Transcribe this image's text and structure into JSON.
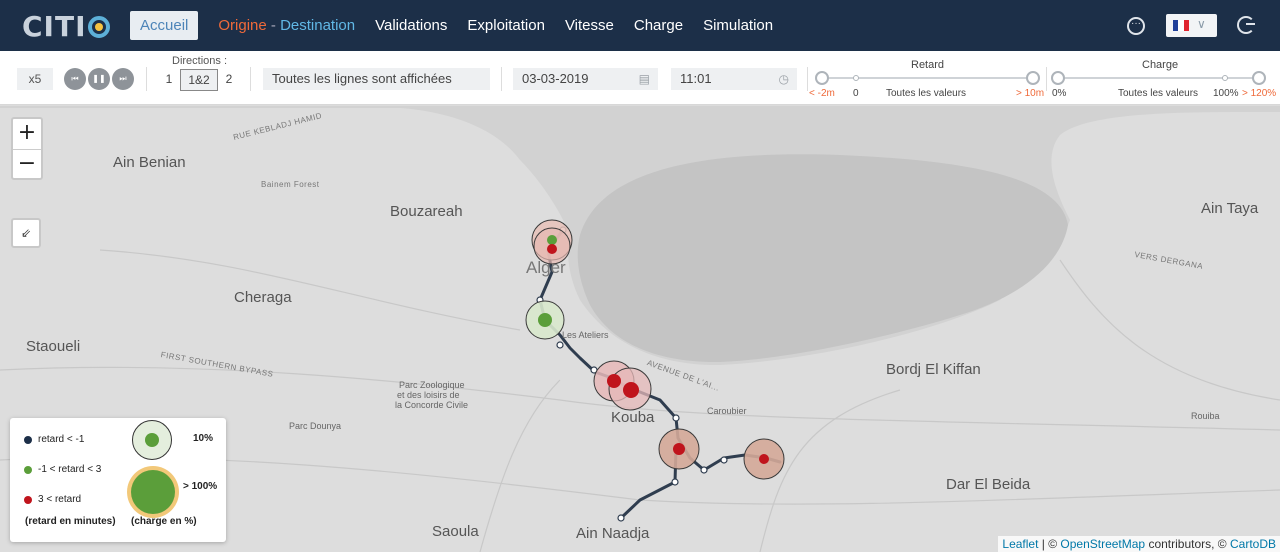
{
  "nav": {
    "logo": "CITI",
    "items": [
      "Accueil",
      "Validations",
      "Exploitation",
      "Vitesse",
      "Charge",
      "Simulation"
    ],
    "origin": "Origine",
    "dash": "-",
    "destination": "Destination"
  },
  "toolbar": {
    "speed": "x5",
    "directions_label": "Directions :",
    "dir1": "1",
    "dir12": "1&2",
    "dir2": "2",
    "lines": "Toutes les lignes sont affichées",
    "date": "03-03-2019",
    "time": "11:01",
    "retard": {
      "title": "Retard",
      "min": "< -2m",
      "zero": "0",
      "all": "Toutes les valeurs",
      "max": "> 10m"
    },
    "charge": {
      "title": "Charge",
      "min": "0%",
      "all": "Toutes les valeurs",
      "hundred": "100%",
      "max": "> 120%"
    }
  },
  "map": {
    "places": [
      "Ain Benian",
      "Bouzareah",
      "Cheraga",
      "Staoueli",
      "Ain Taya",
      "Bordj El Kiffan",
      "Dar El Beida",
      "Kouba",
      "Saoula",
      "Ain Naadja",
      "Alger",
      "Caroubier",
      "Parc Dounya",
      "Parc Zoologique",
      "et des loisirs de",
      "la Concorde Civile",
      "Rouiba",
      "Les Ateliers",
      "Bainem Forest",
      "RUE KEBLADJ HAMID",
      "FIRST SOUTHERN BYPASS",
      "VERS DERGANA",
      "AVENUE DE L'AI..."
    ]
  },
  "legend": {
    "row1": "retard < -1",
    "row2": "-1 < retard < 3",
    "row3": "3 < retard",
    "note1": "(retard en minutes)",
    "pct_low": "10%",
    "pct_high": "> 100%",
    "note2": "(charge en %)"
  },
  "attribution": {
    "leaflet": "Leaflet",
    "sep": " | © ",
    "osm": "OpenStreetMap",
    "contrib": " contributors, © ",
    "carto": "CartoDB"
  },
  "colors": {
    "nav": "#1c2f48",
    "late": "#c0141c",
    "ontime": "#5b9e3a",
    "early": "#1c2f48",
    "route": "#2f3d4f",
    "orange": "#ef6a3a",
    "blue": "#61b8e6"
  }
}
